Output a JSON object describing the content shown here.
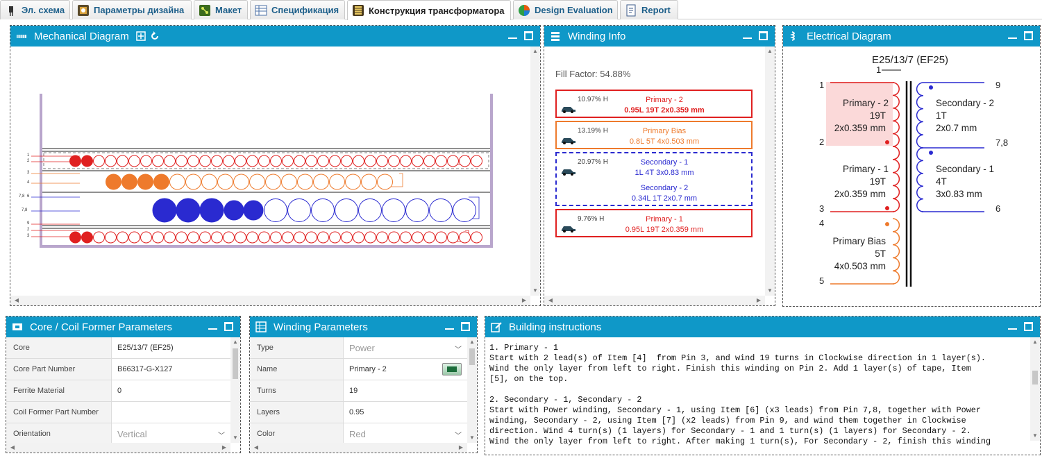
{
  "tabs": [
    {
      "label": "Эл. схема",
      "icon": "schematic-icon",
      "active": false
    },
    {
      "label": "Параметры дизайна",
      "icon": "design-params-icon",
      "active": false
    },
    {
      "label": "Макет",
      "icon": "layout-icon",
      "active": false
    },
    {
      "label": "Спецификация",
      "icon": "bom-icon",
      "active": false
    },
    {
      "label": "Конструкция трансформатора",
      "icon": "transformer-construction-icon",
      "active": true
    },
    {
      "label": "Design Evaluation",
      "icon": "pie-chart-icon",
      "active": false
    },
    {
      "label": "Report",
      "icon": "report-icon",
      "active": false
    }
  ],
  "mechanical": {
    "title": "Mechanical Diagram",
    "pin_labels": [
      "1",
      "2",
      "3",
      "4",
      "7,8",
      "6",
      "7,8",
      "9",
      "2",
      "3"
    ]
  },
  "winding_info": {
    "title": "Winding Info",
    "fill_factor": "Fill Factor: 54.88%",
    "windings": [
      {
        "pct": "10.97% H",
        "name": "Primary - 2",
        "spec": "0.95L 19T 2x0.359 mm",
        "color": "#e02020"
      },
      {
        "pct": "13.19% H",
        "name": "Primary Bias",
        "spec": "0.8L 5T 4x0.503 mm",
        "color": "#ee7a2c"
      },
      {
        "pct": "20.97% H",
        "name": "Secondary - 1",
        "spec": "1L 4T 3x0.83 mm",
        "name2": "Secondary - 2",
        "spec2": "0.34L 1T 2x0.7 mm",
        "color": "#2a2ad0"
      },
      {
        "pct": "9.76% H",
        "name": "Primary - 1",
        "spec": "0.95L 19T 2x0.359 mm",
        "color": "#e02020"
      }
    ]
  },
  "electrical": {
    "title": "Electrical Diagram",
    "core": "E25/13/7 (EF25)",
    "pins": {
      "p1_top": "1",
      "p1": "1",
      "p2": "2",
      "p3": "3",
      "p4": "4",
      "p5": "5",
      "p9": "9",
      "p78": "7,8",
      "p6": "6"
    },
    "primary2": {
      "name": "Primary - 2",
      "turns": "19T",
      "wire": "2x0.359 mm"
    },
    "primary1": {
      "name": "Primary - 1",
      "turns": "19T",
      "wire": "2x0.359 mm"
    },
    "bias": {
      "name": "Primary Bias",
      "turns": "5T",
      "wire": "4x0.503 mm"
    },
    "secondary2": {
      "name": "Secondary - 2",
      "turns": "1T",
      "wire": "2x0.7 mm"
    },
    "secondary1": {
      "name": "Secondary - 1",
      "turns": "4T",
      "wire": "3x0.83 mm"
    }
  },
  "core_params": {
    "title": "Core / Coil Former Parameters",
    "rows": [
      {
        "label": "Core",
        "value": "E25/13/7 (EF25)"
      },
      {
        "label": "Core Part Number",
        "value": "B66317-G-X127"
      },
      {
        "label": "Ferrite Material",
        "value": "0"
      },
      {
        "label": "Coil Former Part Number",
        "value": ""
      },
      {
        "label": "Orientation",
        "value": "Vertical"
      }
    ]
  },
  "winding_params": {
    "title": "Winding Parameters",
    "rows": [
      {
        "label": "Type",
        "value": "Power"
      },
      {
        "label": "Name",
        "value": "Primary - 2"
      },
      {
        "label": "Turns",
        "value": "19"
      },
      {
        "label": "Layers",
        "value": "0.95"
      },
      {
        "label": "Color",
        "value": "Red"
      }
    ]
  },
  "building": {
    "title": "Building instructions",
    "text": "1. Primary - 1\nStart with 2 lead(s) of Item [4]  from Pin 3, and wind 19 turns in Clockwise direction in 1 layer(s).\nWind the only layer from left to right. Finish this winding on Pin 2. Add 1 layer(s) of tape, Item\n[5], on the top.\n\n2. Secondary - 1, Secondary - 2\nStart with Power winding, Secondary - 1, using Item [6] (x3 leads) from Pin 7,8, together with Power\nwinding, Secondary - 2, using Item [7] (x2 leads) from Pin 9, and wind them together in Clockwise\ndirection. Wind 4 turn(s) (1 layers) for Secondary - 1 and 1 turn(s) (1 layers) for Secondary - 2.\nWind the only layer from left to right. After making 1 turn(s), For Secondary - 2, finish this winding"
  },
  "colors": {
    "header": "#0f98c8",
    "red": "#e02020",
    "orange": "#ee7a2c",
    "blue": "#2a2ad0",
    "bobbin": "#b9a6cc"
  }
}
